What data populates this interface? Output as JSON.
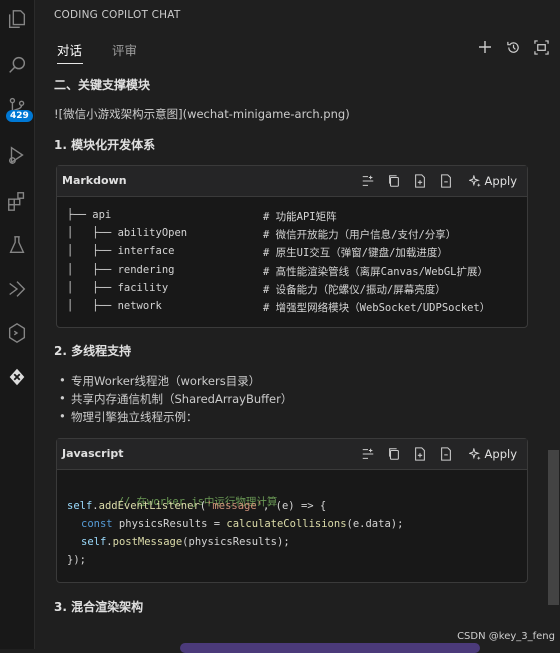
{
  "activity_bar": {
    "badge": "429",
    "icons": [
      "copy-icon",
      "search-icon",
      "source-control-icon",
      "run-debug-icon",
      "extensions-icon",
      "testing-icon",
      "remote-explorer-icon",
      "hexagon-extension-icon",
      "copilot-chat-icon"
    ]
  },
  "panel": {
    "title": "CODING COPILOT CHAT",
    "tabs": [
      {
        "label": "对话",
        "active": true
      },
      {
        "label": "评审",
        "active": false
      }
    ],
    "actions": [
      "plus-icon",
      "history-icon",
      "maximize-icon"
    ]
  },
  "content": {
    "heading2": "二、关键支撑模块",
    "image_link": "![微信小游戏架构示意图](wechat-minigame-arch.png)",
    "section1_title": "1. 模块化开发体系",
    "code1": {
      "lang": "Markdown",
      "apply_label": "Apply",
      "lines": [
        {
          "code": "├── api",
          "comment": "# 功能API矩阵"
        },
        {
          "code": "│   ├── abilityOpen",
          "comment": "# 微信开放能力（用户信息/支付/分享）"
        },
        {
          "code": "│   ├── interface",
          "comment": "# 原生UI交互（弹窗/键盘/加载进度）"
        },
        {
          "code": "│   ├── rendering",
          "comment": "# 高性能渲染管线（离屏Canvas/WebGL扩展）"
        },
        {
          "code": "│   ├── facility",
          "comment": "# 设备能力（陀螺仪/振动/屏幕亮度）"
        },
        {
          "code": "│   ├── network",
          "comment": "# 增强型网络模块（WebSocket/UDPSocket）"
        }
      ]
    },
    "section2_title": "2. 多线程支持",
    "bullets": [
      "专用Worker线程池（workers目录）",
      "共享内存通信机制（SharedArrayBuffer）",
      "物理引擎独立线程示例："
    ],
    "code2": {
      "lang": "Javascript",
      "apply_label": "Apply",
      "comment": "// 在worker.js中运行物理计算",
      "line2_obj": "self",
      "line2_fn": "addEventListener",
      "line2_str": "'message'",
      "line2_rest": ", (e) => {",
      "line3_kw": "const",
      "line3_var": " physicsResults = ",
      "line3_fn": "calculateCollisions",
      "line3_rest": "(e.data);",
      "line4_obj": "self",
      "line4_fn": "postMessage",
      "line4_rest": "(physicsResults);",
      "line5": "});"
    },
    "section3_title": "3. 混合渲染架构"
  },
  "watermark": "CSDN @key_3_feng"
}
